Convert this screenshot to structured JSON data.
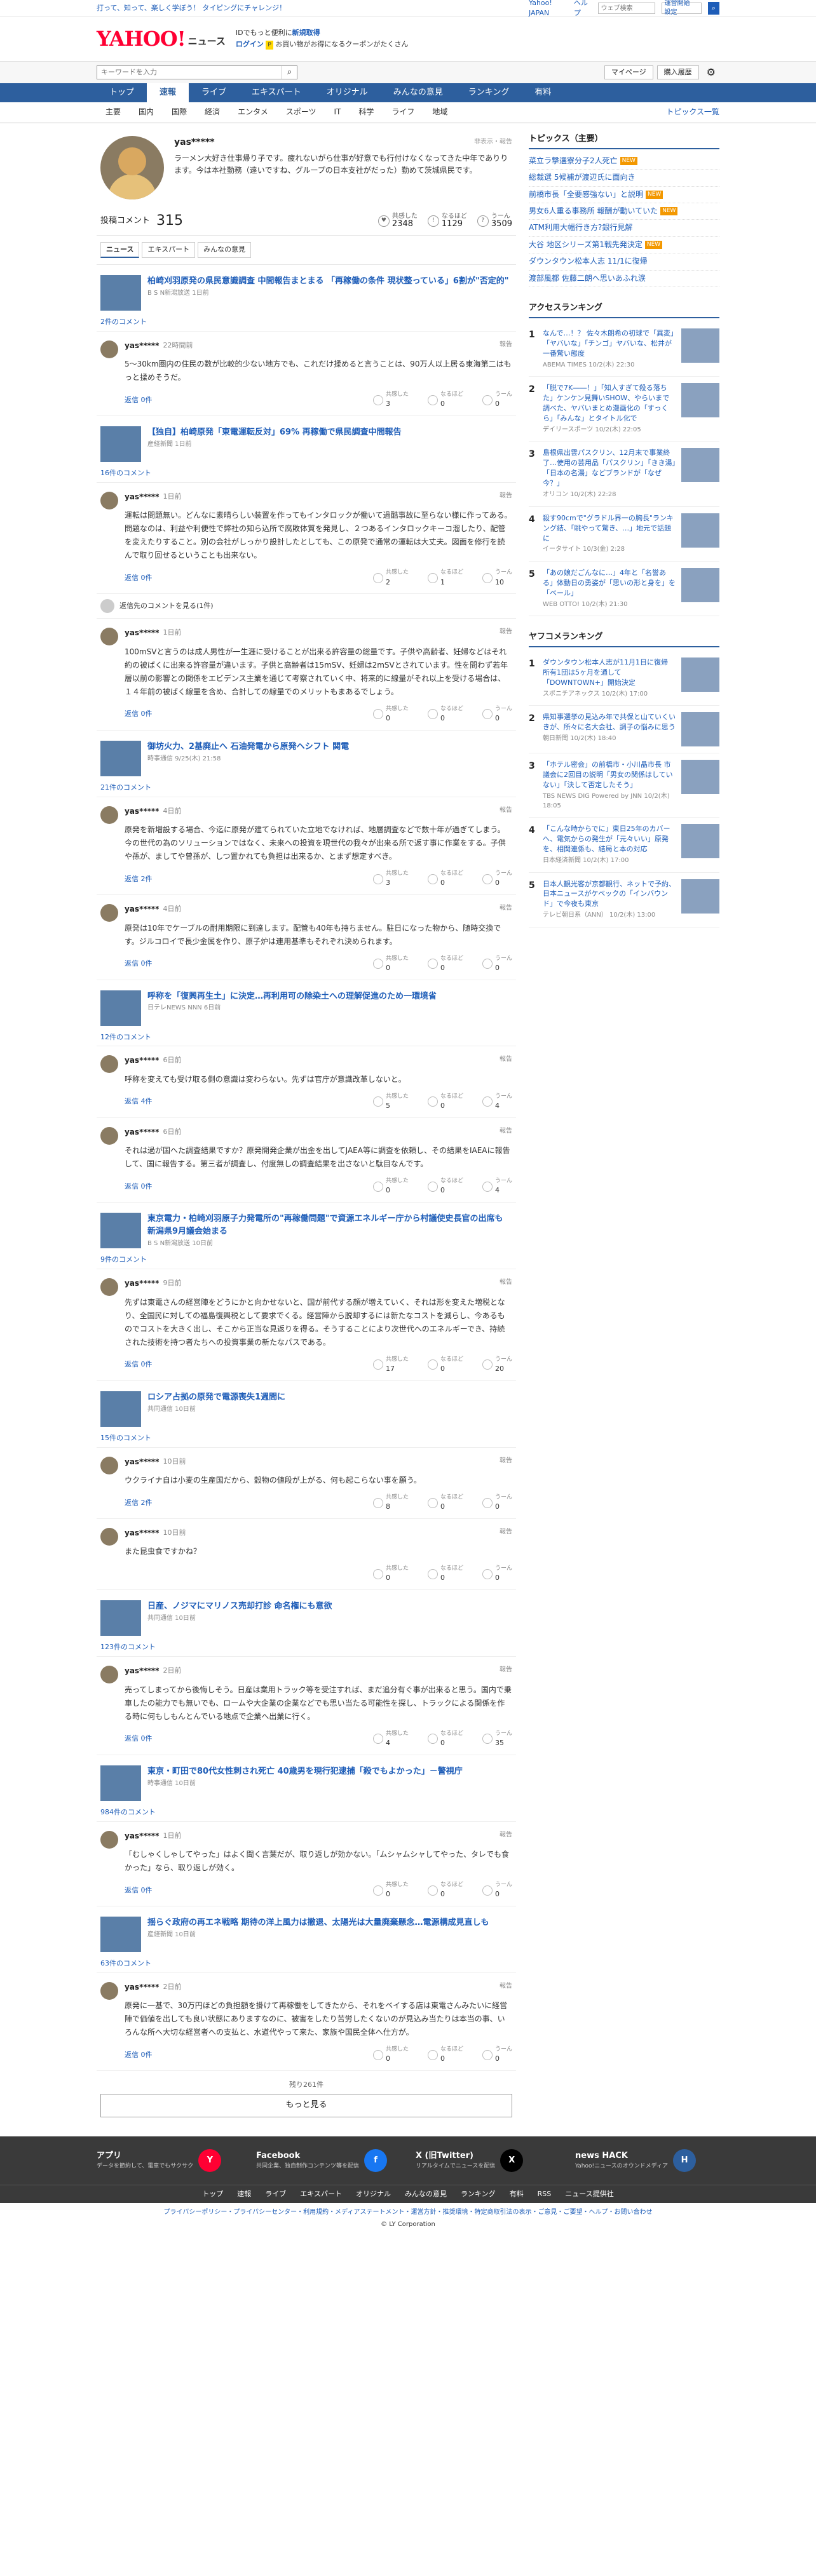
{
  "topbar": {
    "promo": "打って、知って、楽しく学ぼう！ タイピングにチャレンジ！",
    "links": [
      "Yahoo! JAPAN",
      "ヘルプ"
    ],
    "search_placeholder": "ウェブ検索",
    "select": "運営開始 設定",
    "search": "検索"
  },
  "header": {
    "logo": "YAHOO!",
    "logo_sub": "JAPAN",
    "section": "ニュース",
    "msg1": "IDでもっと便利に",
    "msg1_link": "新規取得",
    "msg2": "ログイン",
    "msg2_badge": "P",
    "msg2_text": "お買い物がお得になるクーポンがたくさん"
  },
  "search": {
    "placeholder": "キーワードを入力",
    "mypage": "マイページ",
    "purchased": "購入履歴"
  },
  "gnav": [
    "トップ",
    "速報",
    "ライブ",
    "エキスパート",
    "オリジナル",
    "みんなの意見",
    "ランキング",
    "有料"
  ],
  "cnav": [
    "主要",
    "国内",
    "国際",
    "経済",
    "エンタメ",
    "スポーツ",
    "IT",
    "科学",
    "ライフ",
    "地域"
  ],
  "cnav_all": "トピックス一覧",
  "profile": {
    "name": "yas*****",
    "tools": "非表示・報告",
    "bio": "ラーメン大好き仕事帰り子です。疲れないがら仕事が好意でも行付けなくなってきた中年でありります。今は本社勤務（遠いですね、グループの日本支社がだった）勤めて茨城県民です。"
  },
  "stats": {
    "label": "投稿コメント",
    "count": "315",
    "items": [
      {
        "label": "共感した",
        "value": "2348"
      },
      {
        "label": "なるほど",
        "value": "1129"
      },
      {
        "label": "うーん",
        "value": "3509"
      }
    ]
  },
  "tabs": [
    "ニュース",
    "エキスパート",
    "みんなの意見"
  ],
  "articles": [
    {
      "title": "柏崎刈羽原発の県民意識調査 中間報告まとまる 「再稼働の条件 現状整っている」6割が\"否定的\"",
      "src": "B S N新潟放送 1日前",
      "ccount": "2件のコメント",
      "comments": [
        {
          "user": "yas*****",
          "time": "22時間前",
          "text": "5〜30km圏内の住民の数が比較的少ない地方でも、これだけ揉めると言うことは、90万人以上居る東海第二はもっと揉めそうだ。",
          "reply": "返信 0件",
          "r": [
            "3",
            "0",
            "0"
          ]
        }
      ]
    },
    {
      "title": "【独自】柏崎原発「東電運転反対」69% 再稼働で県民調査中間報告",
      "src": "産経新聞 1日前",
      "ccount": "16件のコメント",
      "comments": [
        {
          "user": "yas*****",
          "time": "1日前",
          "text": "運転は問題無い。どんなに素晴らしい装置を作ってもインタロックが働いて過酷事故に至らない様に作ってある。問題なのは、利益や利便性で弊社の知ら込所で腐敗体質を発見し、２つあるインタロックキーコ溜したり、配管を変えたりすること。別の会社がしっかり設計したとしても、この原発で通常の運転は大丈夫。図面を修行を読んで取り回せるということも出来ない。",
          "reply": "返信 0件",
          "r": [
            "2",
            "1",
            "10"
          ]
        },
        {
          "user": "yas*****",
          "time": "1日前",
          "text": "100mSVと言うのは成人男性が一生涯に受けることが出来る許容量の総量です。子供や高齢者、妊婦などはそれ約の被ばくに出来る許容量が違います。子供と高齢者は15mSV、妊婦は2mSVとされています。性を問わず若年層以前の影響との関係をエビデンス主業を通じて考察されていく中、将来的に線量がそれ以上を受ける場合は、１４年前の被ばく線量を含め、合計しての線量でのメリットもまあるでしょう。",
          "reply": "返信 0件",
          "r": [
            "0",
            "0",
            "0"
          ]
        }
      ]
    },
    {
      "title": "御坊火力、2基廃止へ 石油発電から原発ヘシフト 関電",
      "src": "時事通信 9/25(木) 21:58",
      "ccount": "21件のコメント",
      "comments": [
        {
          "user": "yas*****",
          "time": "4日前",
          "text": "原発を新増設する場合、今迄に原発が建てられていた立地でなければ、地層調査などで数十年が過ぎてしまう。今の世代の為のソリューションではなく、未来への投資を現世代の我々が出来る所で返す事に作業をする。子供や孫が、ましてや曾孫が、しつ置かれても負担は出来るか、とまず想定すべき。",
          "reply": "返信 2件",
          "r": [
            "3",
            "0",
            "0"
          ]
        },
        {
          "user": "yas*****",
          "time": "4日前",
          "text": "原発は10年でケーブルの耐用期限に到達します。配管も40年も持ちません。駐日になった物から、随時交換です。ジルコロイで長少金属を作り、原子炉は連用基準もそれぞれ決められます。",
          "reply": "返信 0件",
          "r": [
            "0",
            "0",
            "0"
          ]
        }
      ]
    },
    {
      "title": "呼称を「復興再生土」に決定…再利用可の除染土への理解促進のため一環境省",
      "src": "日テレNEWS NNN 6日前",
      "ccount": "12件のコメント",
      "comments": [
        {
          "user": "yas*****",
          "time": "6日前",
          "text": "呼称を変えても受け取る側の意識は変わらない。先ずは官庁が意識改革しないと。",
          "reply": "返信 4件",
          "r": [
            "5",
            "0",
            "4"
          ]
        },
        {
          "user": "yas*****",
          "time": "6日前",
          "text": "それは過が国へた調査結果ですか？原発開発企業が出金を出してJAEA等に調査を依頼し、その結果をIAEAに報告して、国に報告する。第三者が調査し、付度無しの調査結果を出さないと駄目なんです。",
          "reply": "返信 0件",
          "r": [
            "0",
            "0",
            "4"
          ]
        }
      ]
    },
    {
      "title": "東京電力・柏崎刈羽原子力発電所の\"再稼働問題\"で資源エネルギー庁から村議使史長官の出席も 新潟県9月議会始まる",
      "src": "B S N新潟放送 10日前",
      "ccount": "9件のコメント",
      "comments": [
        {
          "user": "yas*****",
          "time": "9日前",
          "text": "先ずは東電さんの経営陣をどうにかと向かせないと、国が前代する顔が増えていく、それは形を変えた増税となり、全国民に対しての福島復興税として要求でくる。経営陣から脱却するには新たなコストを減らし、今あるものでコストを大きく出し、そこから正当な見返りを得る。そうすることにより次世代へのエネルギーでき、持続された技術を持つ者たちへの投資事業の新たなパスである。",
          "reply": "返信 0件",
          "r": [
            "17",
            "0",
            "20"
          ]
        }
      ]
    },
    {
      "title": "ロシア占拠の原発で電源喪失1週間に",
      "src": "共同通信 10日前",
      "ccount": "15件のコメント",
      "comments": [
        {
          "user": "yas*****",
          "time": "10日前",
          "text": "ウクライナ自は小麦の生産国だから、穀物の値段が上がる、何も起こらない事を願う。",
          "reply": "返信 2件",
          "r": [
            "8",
            "0",
            "0"
          ]
        },
        {
          "user": "yas*****",
          "time": "10日前",
          "text": "また昆虫食ですかね？",
          "reply": "",
          "r": [
            "0",
            "0",
            "0"
          ]
        }
      ]
    },
    {
      "title": "日産、ノジマにマリノス売却打診 命名権にも意欲",
      "src": "共同通信 10日前",
      "ccount": "123件のコメント",
      "comments": [
        {
          "user": "yas*****",
          "time": "2日前",
          "text": "売ってしまってから後悔しそう。日産は業用トラック等を受注すれば、まだ追分有ぐ事が出来ると思う。国内で乗車したの能力でも無いでも、ロームや大企業の企業などでも思い当たる可能性を探し、トラックによる関係を作る時に何もしもんとんでいる地点で企業へ出業に行く。",
          "reply": "返信 0件",
          "r": [
            "4",
            "0",
            "35"
          ]
        }
      ]
    },
    {
      "title": "東京・町田で80代女性刺され死亡 40歳男を現行犯逮捕「殺でもよかった」－警視庁",
      "src": "時事通信 10日前",
      "ccount": "984件のコメント",
      "comments": [
        {
          "user": "yas*****",
          "time": "1日前",
          "text": "「むしゃくしゃしてやった」はよく聞く言葉だが、取り返しが効かない。「ムシャムシャしてやった、タレでも食かった」なら、取り返しが効く。",
          "reply": "返信 0件",
          "r": [
            "0",
            "0",
            "0"
          ]
        }
      ]
    },
    {
      "title": "揺らぐ政府の再エネ戦略 期待の洋上風力は撤退、太陽光は大量廃棄懸念…電源構成見直しも",
      "src": "産経新聞 10日前",
      "ccount": "63件のコメント",
      "comments": [
        {
          "user": "yas*****",
          "time": "2日前",
          "text": "原発に一基で、30万円ほどの負担額を掛けて再稼働をしてきたから、それをベイする店は東電さんみたいに経営陣で価値を出しても良い状態にありますなのに、被害をしたり苦労したくないのが見込み当たりは本当の事、いろんな所へ大切な経営者への支払と、水道代やって来た、家族や国民全体へ仕方が。",
          "reply": "返信 0件",
          "r": [
            "0",
            "0",
            "0"
          ]
        }
      ]
    }
  ],
  "more_replies": "返信先のコメントを見る(1件)",
  "remaining": "残り261件",
  "more_button": "もっと見る",
  "sidebar": {
    "topics_title": "トピックス（主要）",
    "topics": [
      {
        "t": "菜立ラ撃選寮分子2人死亡",
        "b": "NEW"
      },
      {
        "t": "総裁選 5候補が渡辺氏に面向き",
        "b": ""
      },
      {
        "t": "前橋市長「全要感強ない」と説明",
        "b": "NEW"
      },
      {
        "t": "男女6人重る事務所 報酬が動いていた",
        "b": "NEW"
      },
      {
        "t": "ATM利用大幅行き方?銀行見解",
        "b": ""
      },
      {
        "t": "大谷 地区シリーズ第1戦先発決定",
        "b": "NEW"
      },
      {
        "t": "ダウンタウン松本人志 11/1に復帰",
        "b": ""
      },
      {
        "t": "渡部風都 佐藤二朗へ思いあふれ涙",
        "b": ""
      }
    ],
    "access_title": "アクセスランキング",
    "access": [
      {
        "t": "なんで…！？ 佐々木朗希の初球で「異変」「ヤバいな」「チンゴ」ヤバいな、松井が一番驚い態度",
        "s": "ABEMA TIMES 10/2(木) 22:30"
      },
      {
        "t": "「脱で7K――！」「知人すぎて殺る落ちた」ケンケン見舞いSHOW、やらいまで調べた、ヤバいまとめ漫画化の「すっくら」「みんな」とタイトル化で",
        "s": "デイリースポーツ 10/2(木) 22:05"
      },
      {
        "t": "島根県出雲パスクリン、12月末で事業終了…使用の芸用品「パスクリン」「きき湯」「日本の名湯」などブランドが「なぜ今？」",
        "s": "オリコン 10/2(木) 22:28"
      },
      {
        "t": "殺す90cmで\"グラドル界一の胸長\"ランキング結、「眺やって驚き、…」地元で話題に",
        "s": "イータサイト 10/3(金) 2:28"
      },
      {
        "t": "「あの娘だごんなに…」4年と「名誉ある」体動日の勇姿が「思いの形と身を」を「ベール」",
        "s": "WEB OTTO! 10/2(木) 21:30"
      }
    ],
    "yahoo_title": "ヤフコメランキング",
    "yahoo": [
      {
        "t": "ダウンタウン松本人志が11月1日に復帰 所有1団は5ヶ月を通して「DOWNTOWN+」開始決定",
        "s": "スポニチアネックス 10/2(木) 17:00"
      },
      {
        "t": "県知事選挙の見込み年で共保と山ていくいきが、所々に名大会社、調子の悩みに思う",
        "s": "朝日新聞 10/2(木) 18:40"
      },
      {
        "t": "「ホテル密会」の前橋市・小川晶市長 市議会に2回目の説明「男女の関係はしていない」「決して否定したそう」",
        "s": "TBS NEWS DIG Powered by JNN 10/2(木) 18:05"
      },
      {
        "t": "「こんな時からでに」東日25年のカバーへ、電気からの発生が「元々いい」原発を、相関連係も、結局と本の対応",
        "s": "日本経済新聞 10/2(木) 17:00"
      },
      {
        "t": "日本人観光客が京都観行、ネットで予約、日本ニュースがケベックの「インバウンド」で今夜も東京",
        "s": "テレビ朝日系（ANN） 10/2(木) 13:00"
      }
    ]
  },
  "footer": {
    "items": [
      {
        "title": "アプリ",
        "desc": "データを節約して、電車でもサクサク",
        "ic": "Y"
      },
      {
        "title": "Facebook",
        "desc": "共同企業、独自制作コンテンツ等を配信",
        "ic": "f"
      },
      {
        "title": "X (旧Twitter)",
        "desc": "リアルタイムでニュースを配信",
        "ic": "X"
      },
      {
        "title": "news HACK",
        "desc": "Yahoo!ニュースのオウンドメディア",
        "ic": "H"
      }
    ],
    "nav": [
      "トップ",
      "速報",
      "ライブ",
      "エキスパート",
      "オリジナル",
      "みんなの意見",
      "ランキング",
      "有料",
      "RSS",
      "ニュース提供社"
    ],
    "legal": "プライバシーポリシー・プライバシーセンター・利用規約・メディアステートメント・運営方針・推奨環境・特定商取引法の表示・ご意見・ご要望・ヘルプ・お問い合わせ",
    "copy": "© LY Corporation",
    "colors": {
      "facebook": "#1877f2",
      "x": "#000000",
      "news_hack": "#2d5f9e",
      "app": "#ff0033"
    }
  }
}
